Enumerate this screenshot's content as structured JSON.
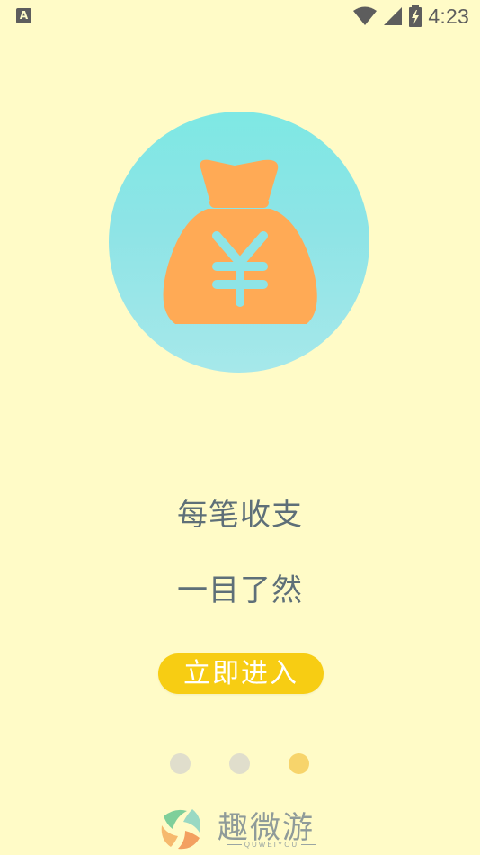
{
  "status_bar": {
    "notification_icon": "A",
    "icons": [
      "wifi-icon",
      "signal-icon",
      "battery-charging-icon"
    ],
    "time": "4:23"
  },
  "hero": {
    "icon": "money-bag-yen-icon",
    "symbol": "¥",
    "colors": {
      "circle": "#8ee4e6",
      "bag": "#ffaa55"
    }
  },
  "slogan": {
    "line1": "每笔收支",
    "line2": "一目了然"
  },
  "enter_button": {
    "label": "立即进入"
  },
  "pager": {
    "count": 3,
    "active_index": 2
  },
  "brand": {
    "name": "趣微游",
    "subtitle": "QUWEIYOU"
  }
}
